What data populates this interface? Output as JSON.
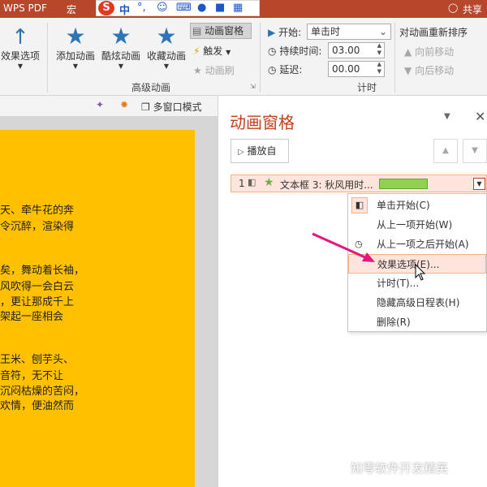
{
  "titlebar": {
    "app": "WPS PDF",
    "macro": "宏",
    "share": "共享"
  },
  "ime": {
    "logo": "S",
    "mode": "中",
    "punct": "°,",
    "emoji": "☺"
  },
  "ribbon": {
    "effect_options": "效果选项",
    "add_animation": "添加动画",
    "cool_animation": "酷炫动画",
    "collect_animation": "收藏动画",
    "animation_pane": "动画窗格",
    "trigger": "触发",
    "animation_painter": "动画刷",
    "group_advanced": "高级动画",
    "start_label": "开始:",
    "start_value": "单击时",
    "duration_label": "持续时间:",
    "duration_value": "03.00",
    "delay_label": "延迟:",
    "delay_value": "00.00",
    "group_timing": "计时",
    "reorder_title": "对动画重新排序",
    "move_earlier": "向前移动",
    "move_later": "向后移动"
  },
  "view_toolbar": {
    "multi_window": "多窗口模式"
  },
  "slide": {
    "lines": [
      "天、牵牛花的奔",
      "令沉醉，渲染得",
      "矣，舞动着长袖，",
      "风吹得一会白云",
      "，更让那成千上",
      "架起一座相会",
      "王米、刨芋头、",
      "音符，无不让",
      "沉闷枯燥的苦闷，",
      "欢情，便油然而"
    ]
  },
  "pane": {
    "title": "动画窗格",
    "play_from": "播放自",
    "item": {
      "index": "1",
      "label": "文本框 3: 秋风用时...",
      "bar_color": "#92d050"
    }
  },
  "context_menu": {
    "items": [
      {
        "label": "单击开始(C)",
        "icon": "mouse-icon"
      },
      {
        "label": "从上一项开始(W)",
        "icon": ""
      },
      {
        "label": "从上一项之后开始(A)",
        "icon": "clock-icon"
      },
      {
        "label": "效果选项(E)...",
        "icon": ""
      },
      {
        "label": "计时(T)...",
        "icon": ""
      },
      {
        "label": "隐藏高级日程表(H)",
        "icon": ""
      },
      {
        "label": "删除(R)",
        "icon": ""
      }
    ]
  },
  "watermark": {
    "text": "知零软件开发精英"
  },
  "colors": {
    "accent": "#b7472a",
    "pane_title": "#c43e1c",
    "arrow": "#e5177e",
    "star_blue": "#2e75b6",
    "star_green": "#70ad47"
  }
}
